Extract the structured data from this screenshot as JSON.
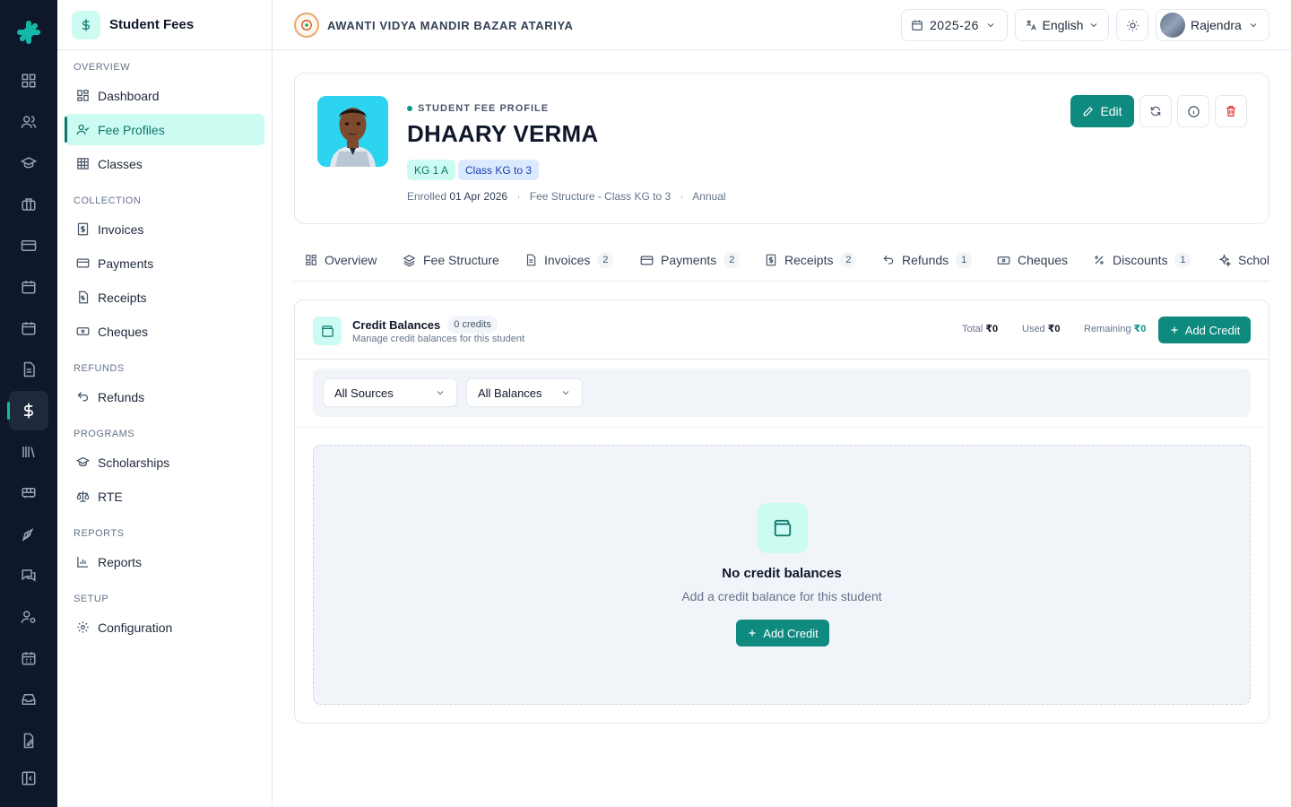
{
  "sidebar": {
    "title": "Student Fees",
    "sections": {
      "overview": "OVERVIEW",
      "collection": "COLLECTION",
      "refunds": "REFUNDS",
      "programs": "PROGRAMS",
      "reports": "REPORTS",
      "setup": "SETUP"
    },
    "items": {
      "dashboard": "Dashboard",
      "fee_profiles": "Fee Profiles",
      "classes": "Classes",
      "invoices": "Invoices",
      "payments": "Payments",
      "receipts": "Receipts",
      "cheques": "Cheques",
      "refunds": "Refunds",
      "scholarships": "Scholarships",
      "rte": "RTE",
      "reports": "Reports",
      "configuration": "Configuration"
    },
    "active_item": "Fee Profiles"
  },
  "topbar": {
    "school_name": "AWANTI VIDYA MANDIR BAZAR ATARIYA",
    "year": "2025-26",
    "language": "English",
    "user": "Rajendra"
  },
  "profile": {
    "eyebrow": "STUDENT FEE PROFILE",
    "name": "DHAARY VERMA",
    "class_chip": "KG 1 A",
    "range_chip": "Class KG to 3",
    "enrolled_label": "Enrolled",
    "enrolled_date": "01 Apr 2026",
    "fee_structure": "Fee Structure - Class KG to 3",
    "frequency": "Annual",
    "edit_label": "Edit"
  },
  "tabs": {
    "overview": "Overview",
    "fee_structure": "Fee Structure",
    "invoices": "Invoices",
    "invoices_count": "2",
    "payments": "Payments",
    "payments_count": "2",
    "receipts": "Receipts",
    "receipts_count": "2",
    "refunds": "Refunds",
    "refunds_count": "1",
    "cheques": "Cheques",
    "discounts": "Discounts",
    "discounts_count": "1",
    "scholarships": "Schol"
  },
  "credit": {
    "title": "Credit Balances",
    "count": "0 credits",
    "subtitle": "Manage credit balances for this student",
    "total_label": "Total",
    "total_value": "₹0",
    "used_label": "Used",
    "used_value": "₹0",
    "remaining_label": "Remaining",
    "remaining_value": "₹0",
    "add_label": "Add Credit",
    "filter_sources": "All Sources",
    "filter_balances": "All Balances",
    "empty_title": "No credit balances",
    "empty_subtitle": "Add a credit balance for this student",
    "empty_button": "Add Credit"
  },
  "colors": {
    "accent": "#0f8a7f",
    "accent_light": "#ccfbf1",
    "rail_bg": "#0f172a"
  },
  "icons": {
    "rail": [
      "grid-icon",
      "users-icon",
      "graduation-cap-icon",
      "briefcase-icon",
      "card-icon",
      "calendar-icon",
      "calendar-check-icon",
      "file-icon",
      "dollar-icon",
      "library-icon",
      "bus-icon",
      "pen-tool-icon",
      "messages-icon",
      "user-cog-icon",
      "calendar-days-icon",
      "inbox-icon",
      "file-edit-icon",
      "sidebar-collapse-icon"
    ]
  }
}
